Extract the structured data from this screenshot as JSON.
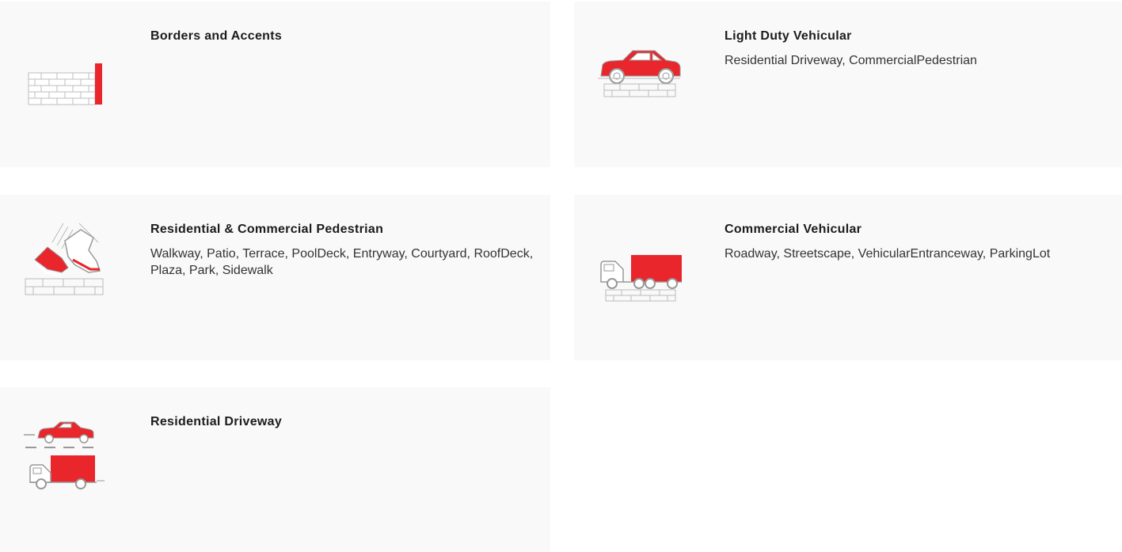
{
  "accent_color": "#e8262b",
  "cards": [
    {
      "title": "Borders and Accents",
      "description": "",
      "icon": "brick-wall-border-icon"
    },
    {
      "title": "Light Duty Vehicular",
      "description": "Residential Driveway, CommercialPedestrian",
      "icon": "car-on-pavers-icon"
    },
    {
      "title": "Residential & Commercial Pedestrian",
      "description": "Walkway, Patio, Terrace, PoolDeck, Entryway, Courtyard, RoofDeck, Plaza, Park, Sidewalk",
      "icon": "walking-shoes-icon"
    },
    {
      "title": "Commercial Vehicular",
      "description": "Roadway, Streetscape, VehicularEntranceway, ParkingLot",
      "icon": "truck-on-pavers-icon"
    },
    {
      "title": "Residential Driveway",
      "description": "",
      "icon": "car-and-van-icon"
    }
  ]
}
